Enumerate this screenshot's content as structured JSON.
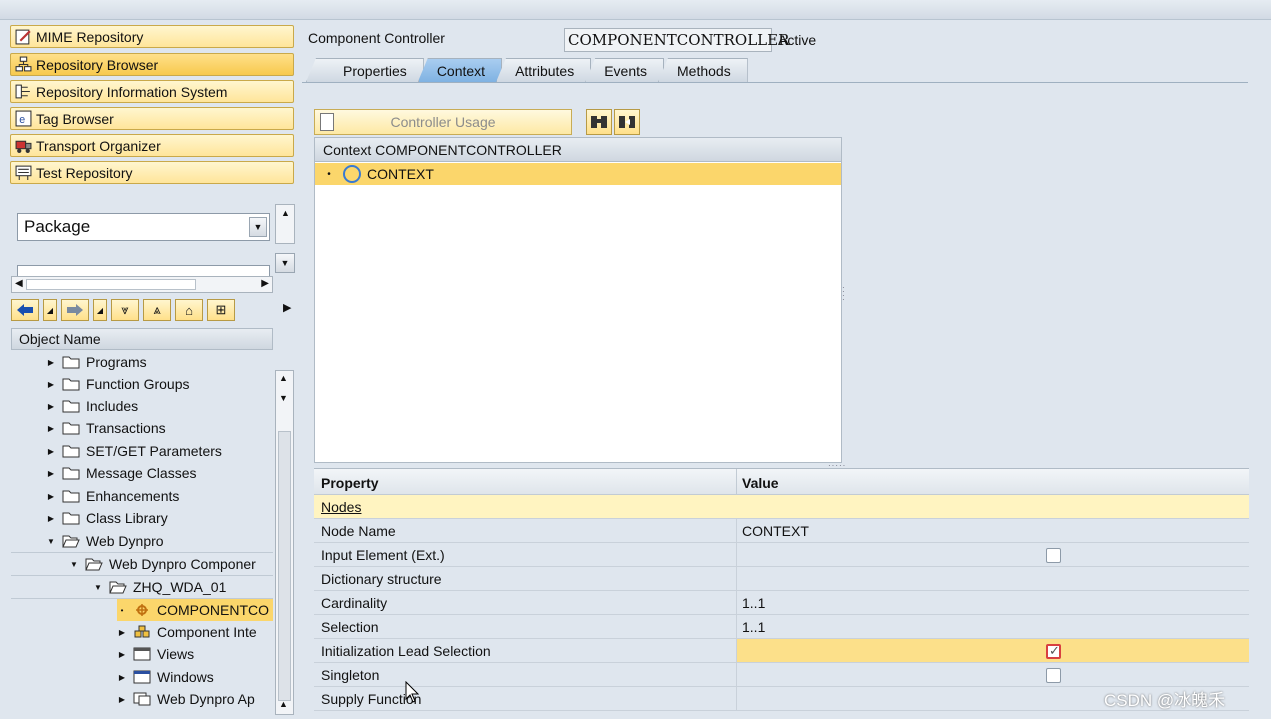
{
  "left_nav": {
    "buttons": [
      {
        "label": "MIME Repository",
        "icon": "mime-icon"
      },
      {
        "label": "Repository Browser",
        "icon": "hierarchy-icon",
        "active": true
      },
      {
        "label": "Repository Information System",
        "icon": "info-system-icon"
      },
      {
        "label": "Tag Browser",
        "icon": "tag-icon"
      },
      {
        "label": "Transport Organizer",
        "icon": "truck-icon"
      },
      {
        "label": "Test Repository",
        "icon": "test-icon"
      }
    ],
    "object_type_select": "Package",
    "tree_header": "Object Name",
    "tree": [
      {
        "label": "Programs",
        "expanded": false
      },
      {
        "label": "Function Groups",
        "expanded": false
      },
      {
        "label": "Includes",
        "expanded": false
      },
      {
        "label": "Transactions",
        "expanded": false
      },
      {
        "label": "SET/GET Parameters",
        "expanded": false
      },
      {
        "label": "Message Classes",
        "expanded": false
      },
      {
        "label": "Enhancements",
        "expanded": false
      },
      {
        "label": "Class Library",
        "expanded": false
      },
      {
        "label": "Web Dynpro",
        "expanded": true
      },
      {
        "label": "Web Dynpro Componer",
        "expanded": true
      },
      {
        "label": "ZHQ_WDA_01",
        "expanded": true
      },
      {
        "label": "COMPONENTCO",
        "selected": true
      },
      {
        "label": "Component Inte",
        "expanded": false
      },
      {
        "label": "Views",
        "expanded": false
      },
      {
        "label": "Windows",
        "expanded": false
      },
      {
        "label": "Web Dynpro Ap",
        "expanded": false
      }
    ]
  },
  "editor": {
    "controller_label": "Component Controller",
    "controller_name": "COMPONENTCONTROLLER",
    "status": "Active",
    "tabs": [
      "Properties",
      "Context",
      "Attributes",
      "Events",
      "Methods"
    ],
    "active_tab": "Context",
    "controller_usage_label": "Controller Usage",
    "context_header": "Context COMPONENTCONTROLLER",
    "context_root": "CONTEXT"
  },
  "properties": {
    "col_property": "Property",
    "col_value": "Value",
    "group": "Nodes",
    "rows": [
      {
        "name": "Node Name",
        "value": "CONTEXT"
      },
      {
        "name": "Input Element (Ext.)",
        "checkbox": false
      },
      {
        "name": "Dictionary structure",
        "value": ""
      },
      {
        "name": "Cardinality",
        "value": "1..1"
      },
      {
        "name": "Selection",
        "value": "1..1"
      },
      {
        "name": "Initialization Lead Selection",
        "checkbox": true
      },
      {
        "name": "Singleton",
        "checkbox": false
      },
      {
        "name": "Supply Function",
        "value": ""
      }
    ]
  },
  "watermark": "CSDN @冰魄禾",
  "colors": {
    "accent_yellow": "#fbd66b",
    "tab_active": "#7fb2e2"
  }
}
